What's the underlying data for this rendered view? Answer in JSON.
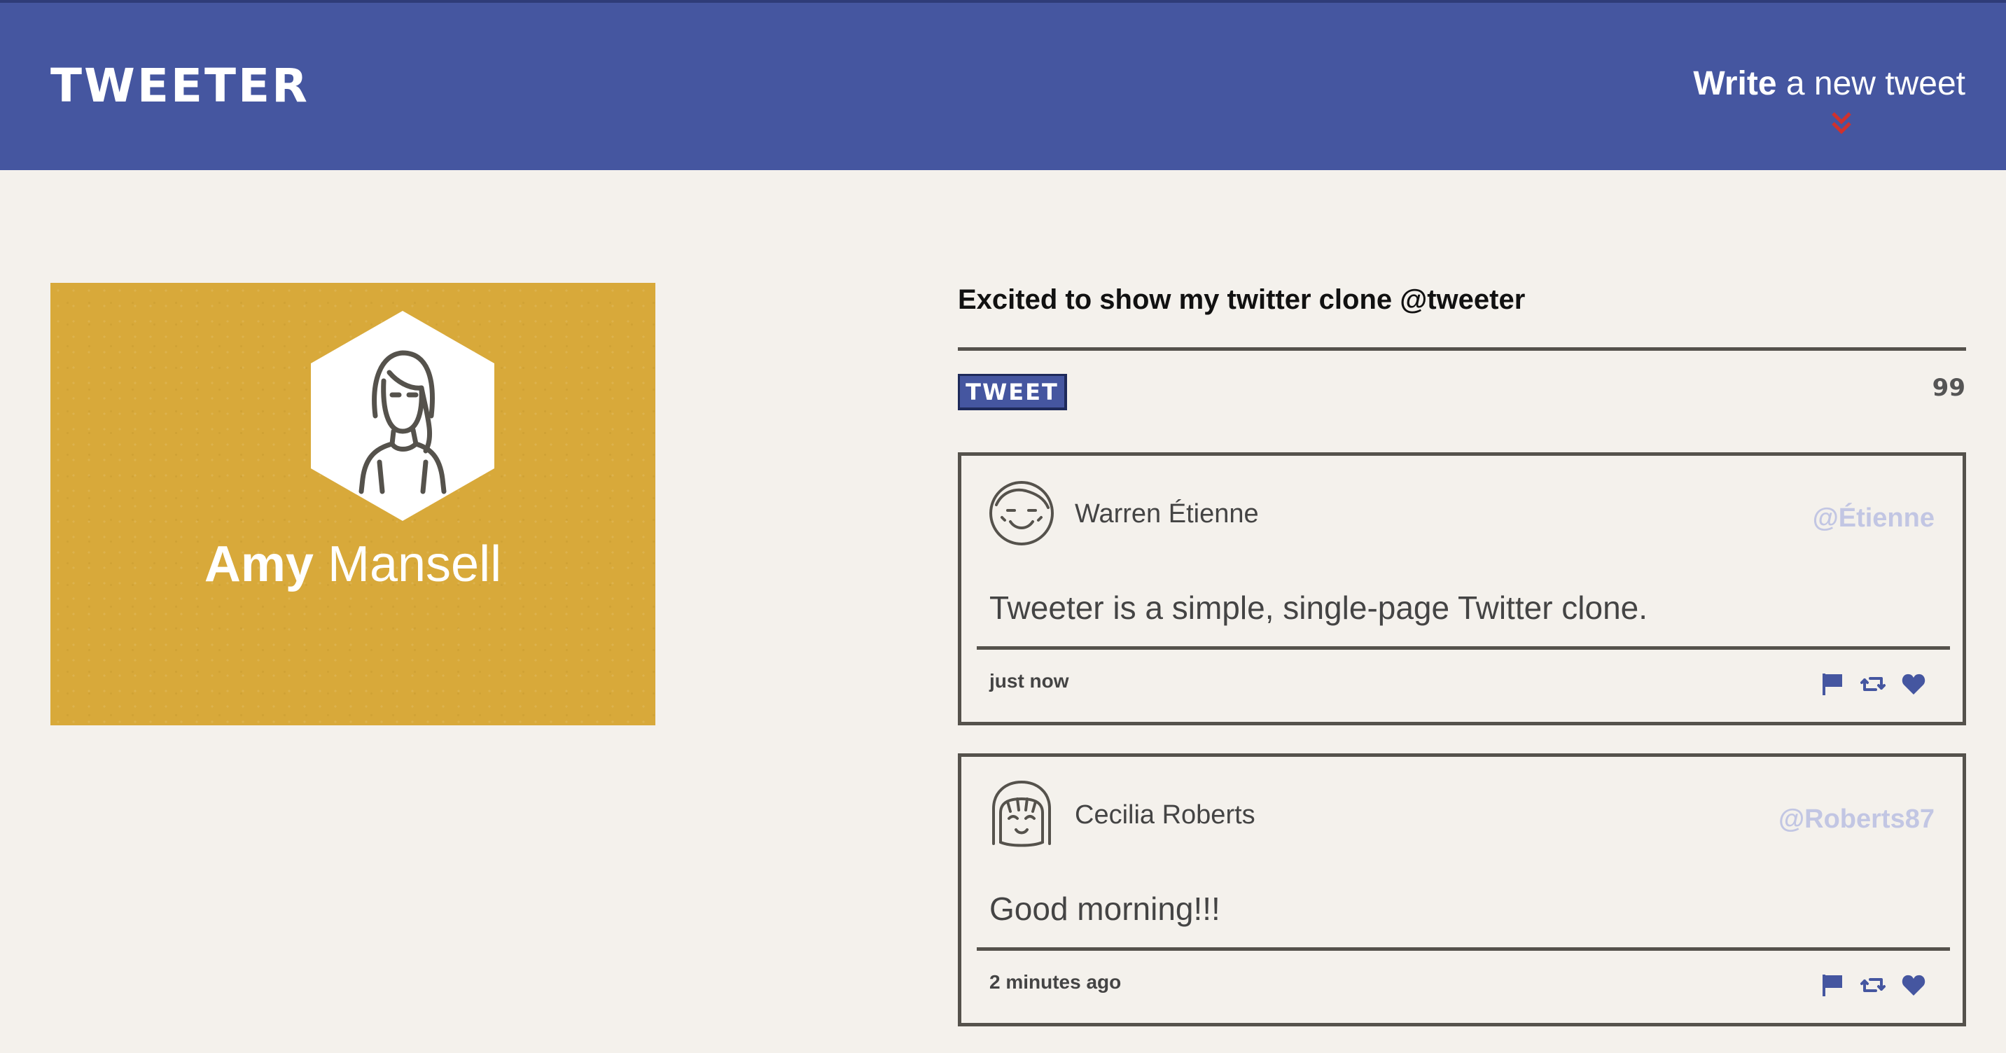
{
  "nav": {
    "brand": "TWEETER",
    "compose_toggle_bold": "Write",
    "compose_toggle_rest": " a new tweet",
    "colors": {
      "bar": "#4556a0",
      "chevron": "#d0312d"
    },
    "chevron_icon": "double-chevron-down-icon"
  },
  "profile": {
    "first_name": "Amy",
    "last_name": "Mansell",
    "avatar_icon": "woman-avatar-icon",
    "card_color": "#d8a93a"
  },
  "compose": {
    "text": "Excited to show my twitter clone @tweeter",
    "submit_label": "TWEET",
    "char_counter": "99"
  },
  "tweets": [
    {
      "name": "Warren Étienne",
      "handle": "@Étienne",
      "body": "Tweeter is a simple, single-page Twitter clone.",
      "time": "just now",
      "avatar_icon": "smiling-man-avatar-icon"
    },
    {
      "name": "Cecilia Roberts",
      "handle": "@Roberts87",
      "body": "Good morning!!!",
      "time": "2 minutes ago",
      "avatar_icon": "girl-bangs-avatar-icon"
    }
  ],
  "action_icons": [
    "flag-icon",
    "retweet-icon",
    "heart-icon"
  ],
  "action_color": "#4556a0"
}
